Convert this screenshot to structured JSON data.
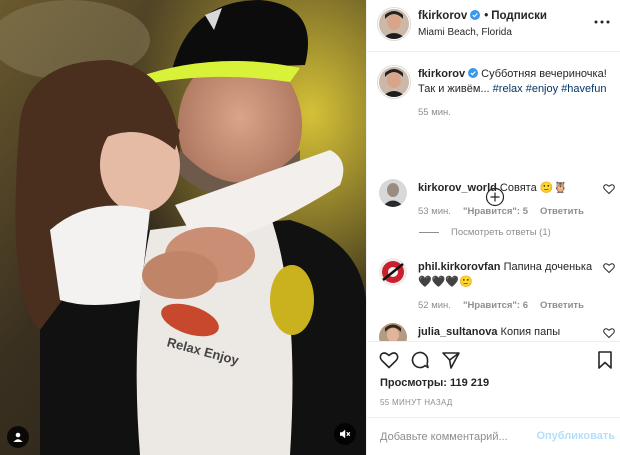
{
  "post": {
    "media": {
      "description_icons": {
        "left": "user-tag-icon",
        "right": "sound-off-icon"
      }
    },
    "header": {
      "username": "fkirkorov",
      "separator": "•",
      "follow_label": "Подписки",
      "location": "Miami Beach, Florida",
      "more_icon": "more-horizontal-icon"
    },
    "caption": {
      "username": "fkirkorov",
      "text_line1": "Субботняя вечериночка!",
      "text_line2": "Так и живём... ",
      "hashtags": [
        "#relax",
        "#enjoy",
        "#havefun"
      ],
      "time": "55 мин."
    },
    "load_more_icon": "plus-circle-icon",
    "comments": [
      {
        "username": "kirkorov_world",
        "text": "Совята 🙂🦉",
        "time": "53 мин.",
        "likes": "\"Нравится\": 5",
        "reply": "Ответить"
      },
      {
        "username": "phil.kirkorovfan",
        "text": "Папина доченька🖤🖤🖤🙂",
        "time": "52 мин.",
        "likes": "\"Нравится\": 6",
        "reply": "Ответить"
      },
      {
        "username": "julia_sultanova",
        "text": "Копия папы"
      }
    ],
    "view_replies": "Посмотреть ответы (1)",
    "views": {
      "label": "Просмотры:",
      "count": "119 219"
    },
    "timestamp": "55 МИНУТ НАЗАД",
    "composer": {
      "placeholder": "Добавьте комментарий...",
      "publish_label": "Опубликовать"
    },
    "colors": {
      "link": "#00376b",
      "verified": "#3897f0",
      "publish_disabled": "#b2dffc",
      "muted": "#8e8e8e"
    }
  }
}
